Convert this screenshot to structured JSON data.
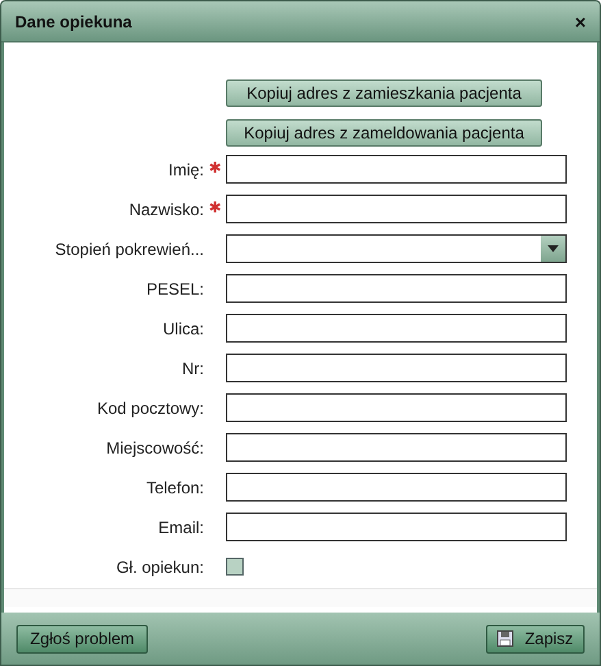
{
  "window": {
    "title": "Dane opiekuna",
    "close": "×"
  },
  "required_mark": "✱",
  "copy_buttons": [
    "Kopiuj adres z zamieszkania pacjenta",
    "Kopiuj adres z zameldowania pacjenta"
  ],
  "fields": [
    {
      "kind": "text",
      "label": "Imię:",
      "required": true
    },
    {
      "kind": "text",
      "label": "Nazwisko:",
      "required": true
    },
    {
      "kind": "select",
      "label": "Stopień pokrewień...",
      "required": false
    },
    {
      "kind": "text",
      "label": "PESEL:",
      "required": false
    },
    {
      "kind": "text",
      "label": "Ulica:",
      "required": false
    },
    {
      "kind": "text",
      "label": "Nr:",
      "required": false
    },
    {
      "kind": "text",
      "label": "Kod pocztowy:",
      "required": false
    },
    {
      "kind": "text",
      "label": "Miejscowość:",
      "required": false
    },
    {
      "kind": "text",
      "label": "Telefon:",
      "required": false
    },
    {
      "kind": "text",
      "label": "Email:",
      "required": false
    },
    {
      "kind": "checkbox",
      "label": "Gł. opiekun:",
      "required": false,
      "checked": false
    }
  ],
  "footer": {
    "report_button": "Zgłoś problem",
    "save_button": "Zapisz"
  }
}
